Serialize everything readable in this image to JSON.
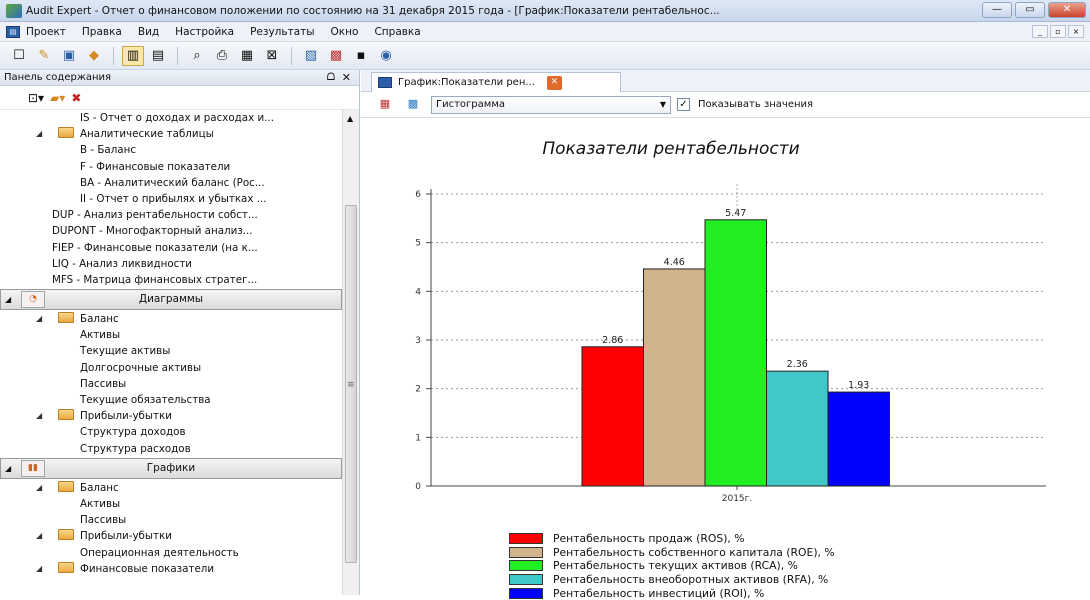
{
  "window": {
    "title": "Audit Expert - Отчет о финансовом положении по состоянию на 31 декабря 2015 года  - [График:Показатели рентабельнос...",
    "buttons": [
      "—",
      "▭",
      "✕"
    ]
  },
  "menu": {
    "items": [
      "Проект",
      "Правка",
      "Вид",
      "Настройка",
      "Результаты",
      "Окно",
      "Справка"
    ],
    "mdi": [
      "_",
      "▫",
      "×"
    ]
  },
  "toolbar": {
    "icons": [
      "new-file-icon",
      "open-icon",
      "save-icon",
      "export-icon",
      "layout-icon",
      "list-icon",
      "preview-icon",
      "print-icon",
      "calc-icon",
      "table-icon",
      "grid-icon",
      "sheet-icon",
      "disk-icon",
      "help-icon"
    ]
  },
  "panel": {
    "title": "Панель содержания",
    "pin": "ᗝ",
    "close": "✕"
  },
  "tree": {
    "top": [
      {
        "text": "IS - Отчет о доходах и расходах и...",
        "indent": 80
      },
      {
        "text": "Аналитические таблицы",
        "indent": 58,
        "folder": true,
        "arrow": true
      },
      {
        "text": "B - Баланс",
        "indent": 80
      },
      {
        "text": "F - Финансовые показатели",
        "indent": 80
      },
      {
        "text": "BA - Аналитический баланс (Рос...",
        "indent": 80
      },
      {
        "text": "II - Отчет о прибылях и убытках ...",
        "indent": 80
      },
      {
        "text": "DUP - Анализ рентабельности собст...",
        "indent": 52
      },
      {
        "text": "DUPONT - Многофакторный анализ...",
        "indent": 52
      },
      {
        "text": "FIEP - Финансовые показатели (на к...",
        "indent": 52
      },
      {
        "text": "LIQ - Анализ ликвидности",
        "indent": 52
      },
      {
        "text": "MFS - Матрица финансовых стратег...",
        "indent": 52
      }
    ],
    "group1": "Диаграммы",
    "mid": [
      {
        "text": "Баланс",
        "indent": 58,
        "folder": true,
        "arrow": true
      },
      {
        "text": "Активы",
        "indent": 80
      },
      {
        "text": "Текущие активы",
        "indent": 80
      },
      {
        "text": "Долгосрочные активы",
        "indent": 80
      },
      {
        "text": "Пассивы",
        "indent": 80
      },
      {
        "text": "Текущие обязательства",
        "indent": 80
      },
      {
        "text": "Прибыли-убытки",
        "indent": 58,
        "folder": true,
        "arrow": true
      },
      {
        "text": "Структура доходов",
        "indent": 80
      },
      {
        "text": "Структура расходов",
        "indent": 80
      }
    ],
    "group2": "Графики",
    "bottom": [
      {
        "text": "Баланс",
        "indent": 58,
        "folder": true,
        "arrow": true
      },
      {
        "text": "Активы",
        "indent": 80
      },
      {
        "text": "Пассивы",
        "indent": 80
      },
      {
        "text": "Прибыли-убытки",
        "indent": 58,
        "folder": true,
        "arrow": true
      },
      {
        "text": "Операционная деятельность",
        "indent": 80
      },
      {
        "text": "Финансовые показатели",
        "indent": 58,
        "folder": true,
        "arrow": true
      }
    ]
  },
  "tab": {
    "label": "График:Показатели рен...",
    "close": "✕"
  },
  "chart_toolbar": {
    "type_select": "Гистограмма",
    "show_values_label": "Показывать значения",
    "show_values": true
  },
  "chart_data": {
    "type": "bar",
    "title": "Показатели рентабельности",
    "categories": [
      "2015г."
    ],
    "ylim": [
      0,
      6
    ],
    "yticks": [
      0,
      1,
      2,
      3,
      4,
      5,
      6
    ],
    "grid": true,
    "legend_position": "bottom",
    "series": [
      {
        "name": "Рентабельность продаж (ROS), %",
        "values": [
          2.86
        ],
        "label": "2.86",
        "color": "#ff0000"
      },
      {
        "name": "Рентабельность собственного капитала (ROE), %",
        "values": [
          4.46
        ],
        "label": "4.46",
        "color": "#d2b48c"
      },
      {
        "name": "Рентабельность текущих активов (RCA), %",
        "values": [
          5.47
        ],
        "label": "5.47",
        "color": "#22ee22"
      },
      {
        "name": "Рентабельность внеоборотных активов (RFA), %",
        "values": [
          2.36
        ],
        "label": "2.36",
        "color": "#40c8c8"
      },
      {
        "name": "Рентабельность инвестиций (ROI), %",
        "values": [
          1.93
        ],
        "label": "1.93",
        "color": "#0000ff"
      }
    ]
  }
}
